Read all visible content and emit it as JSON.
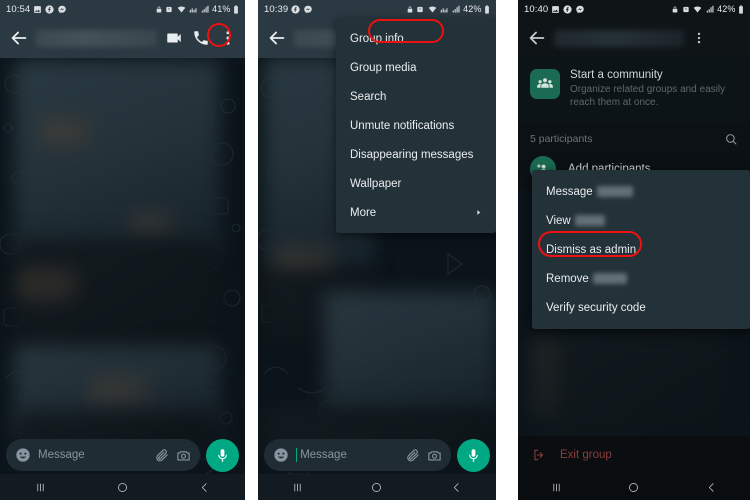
{
  "panels": [
    {
      "id": "chat-screen",
      "status": {
        "time": "10:54",
        "battery": "41%",
        "left_icons": [
          "gallery-icon",
          "facebook-icon",
          "messenger-icon"
        ],
        "right_icons": [
          "vpn-key-icon",
          "alarm-icon",
          "wifi-icon",
          "dual-sim-icon",
          "signal-icon"
        ]
      },
      "appbar": {
        "back": "back-arrow",
        "actions": [
          "video-call-icon",
          "voice-call-icon",
          "overflow-menu-icon"
        ]
      },
      "input": {
        "placeholder": "Message",
        "emoji": "emoji-icon",
        "attach": "paperclip-icon",
        "camera": "camera-icon",
        "mic": "microphone-icon"
      },
      "nav": {
        "recents": "recents-icon",
        "home": "home-icon",
        "back": "back-icon"
      },
      "highlight": "overflow-menu-icon"
    },
    {
      "id": "overflow-menu-screen",
      "status": {
        "time": "10:39",
        "battery": "42%",
        "left_icons": [
          "facebook-icon",
          "messenger-icon"
        ],
        "right_icons": [
          "vpn-key-icon",
          "alarm-icon",
          "wifi-icon",
          "dual-sim-icon",
          "signal-icon"
        ]
      },
      "menu_items": [
        {
          "label": "Group info",
          "highlighted": true,
          "submenu": false
        },
        {
          "label": "Group media",
          "highlighted": false,
          "submenu": false
        },
        {
          "label": "Search",
          "highlighted": false,
          "submenu": false
        },
        {
          "label": "Unmute notifications",
          "highlighted": false,
          "submenu": false
        },
        {
          "label": "Disappearing messages",
          "highlighted": false,
          "submenu": false
        },
        {
          "label": "Wallpaper",
          "highlighted": false,
          "submenu": false
        },
        {
          "label": "More",
          "highlighted": false,
          "submenu": true,
          "submenu_icon": "chevron-right-icon"
        }
      ],
      "input": {
        "placeholder": "Message",
        "emoji": "emoji-icon",
        "attach": "paperclip-icon",
        "camera": "camera-icon",
        "mic": "microphone-icon"
      },
      "nav": {
        "recents": "recents-icon",
        "home": "home-icon",
        "back": "back-icon"
      }
    },
    {
      "id": "group-info-screen",
      "status": {
        "time": "10:40",
        "battery": "42%",
        "left_icons": [
          "gallery-icon",
          "facebook-icon",
          "messenger-icon"
        ],
        "right_icons": [
          "vpn-key-icon",
          "alarm-icon",
          "wifi-icon",
          "signal-icon"
        ]
      },
      "appbar": {
        "back": "back-arrow",
        "actions": [
          "overflow-menu-icon"
        ]
      },
      "community": {
        "icon": "community-icon",
        "title": "Start a community",
        "subtitle": "Organize related groups and easily reach them at once."
      },
      "participants": {
        "count_label": "5 participants",
        "search_icon": "search-icon"
      },
      "add_participants": {
        "icon": "add-person-icon",
        "label": "Add participants"
      },
      "context_menu": [
        {
          "label": "Message",
          "redacted": true,
          "highlighted": false
        },
        {
          "label": "View",
          "redacted": true,
          "highlighted": false
        },
        {
          "label": "Dismiss as admin",
          "redacted": false,
          "highlighted": true
        },
        {
          "label": "Remove",
          "redacted": true,
          "highlighted": false
        },
        {
          "label": "Verify security code",
          "redacted": false,
          "highlighted": false
        }
      ],
      "exit": {
        "icon": "exit-icon",
        "label": "Exit group"
      },
      "nav": {
        "recents": "recents-icon",
        "home": "home-icon",
        "back": "back-icon"
      }
    }
  ],
  "colors": {
    "highlight_ring": "#ee1111",
    "accent_green": "#00a884",
    "appbar": "#2b3942",
    "menu_bg": "#233138",
    "chat_bg": "#0b141a",
    "exit_red": "#8d3b3b"
  }
}
